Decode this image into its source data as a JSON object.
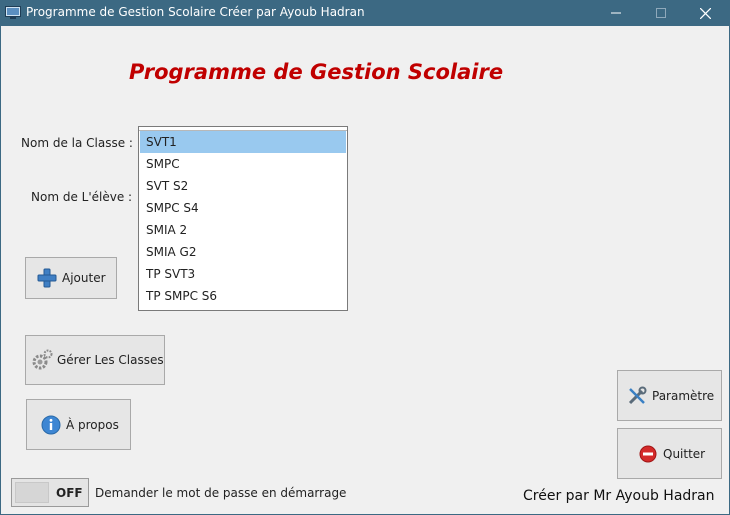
{
  "window": {
    "title": "Programme de Gestion Scolaire Créer par Ayoub Hadran",
    "min_symbol": "—",
    "max_symbol": "☐",
    "close_symbol": "✕"
  },
  "heading": "Programme de Gestion Scolaire",
  "form": {
    "classe_label": "Nom de la Classe :",
    "eleve_label": "Nom de L'élève :"
  },
  "class_list": {
    "selected": "SVT1",
    "items": [
      "SVT1",
      "SMPC",
      "SVT S2",
      "SMPC S4",
      "SMIA 2",
      "SMIA G2",
      "TP SVT3",
      "TP SMPC S6"
    ]
  },
  "buttons": {
    "ajouter": "Ajouter",
    "gerer_classes": "Gérer Les Classes",
    "apropos": "À propos",
    "parametre": "Paramètre",
    "quitter": "Quitter"
  },
  "toggle": {
    "state": "OFF",
    "label": "Demander le mot de passe en démarrage"
  },
  "credit": "Créer par Mr Ayoub Hadran",
  "colors": {
    "titlebar": "#3c6983",
    "heading": "#c00000",
    "selection": "#99c9ef",
    "background": "#f0f0f0"
  },
  "icons": {
    "ajouter": "plus-icon",
    "gerer_classes": "gears-icon",
    "apropos": "info-icon",
    "parametre": "tools-icon",
    "quitter": "stop-icon"
  }
}
